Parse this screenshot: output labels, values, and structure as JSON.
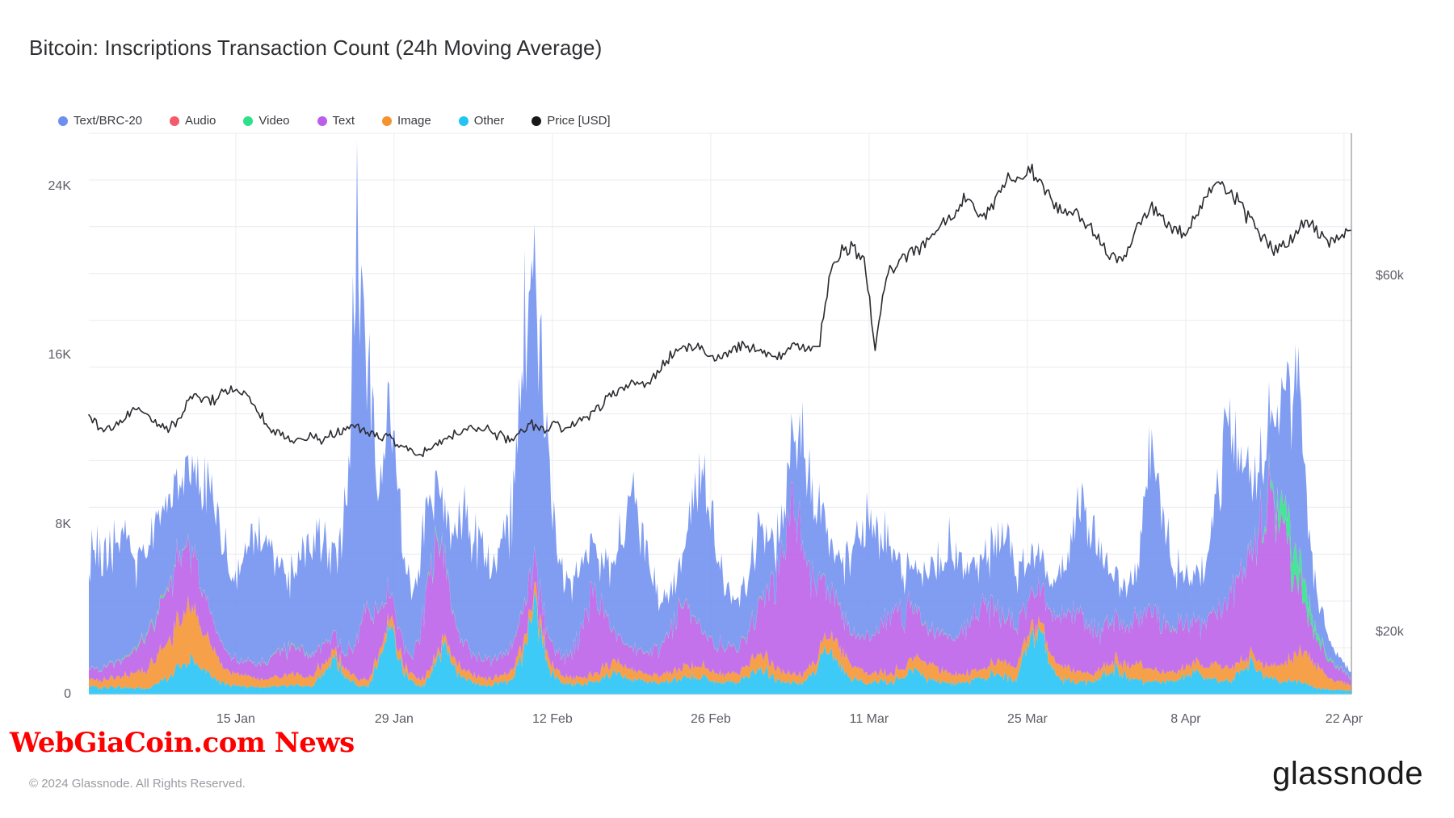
{
  "header": {
    "title": "Bitcoin: Inscriptions Transaction Count (24h Moving Average)"
  },
  "footer": {
    "copyright": "© 2024 Glassnode. All Rights Reserved.",
    "brand": "glassnode",
    "watermark": "WebGiaCoin.com News"
  },
  "legend": [
    {
      "label": "Text/BRC-20",
      "color": "#6f8ff0"
    },
    {
      "label": "Audio",
      "color": "#f45b6a"
    },
    {
      "label": "Video",
      "color": "#2fe08a"
    },
    {
      "label": "Text",
      "color": "#bb5ee8"
    },
    {
      "label": "Image",
      "color": "#f59331"
    },
    {
      "label": "Other",
      "color": "#22c3f5"
    },
    {
      "label": "Price [USD]",
      "color": "#18181b"
    }
  ],
  "chart_data": {
    "type": "area",
    "title": "Bitcoin: Inscriptions Transaction Count (24h Moving Average)",
    "stacked": true,
    "grid": true,
    "legend_position": "top-left",
    "xlabel": "",
    "ylabel": "",
    "x_tick_labels": [
      "15 Jan",
      "29 Jan",
      "12 Feb",
      "26 Feb",
      "11 Mar",
      "25 Mar",
      "8 Apr",
      "22 Apr"
    ],
    "x_tick_positions": [
      0.1164,
      0.2418,
      0.3672,
      0.4926,
      0.618,
      0.7434,
      0.8688,
      0.9942
    ],
    "x_range": [
      "2024-01-01",
      "2024-04-23"
    ],
    "n_points": 114,
    "left_axis": {
      "label": "Inscriptions Transaction Count",
      "tick_labels": [
        "0",
        "8K",
        "16K",
        "24K"
      ],
      "tick_values": [
        0,
        8000,
        16000,
        24000
      ],
      "ylim": [
        0,
        26500
      ],
      "unit": "transactions"
    },
    "right_axis": {
      "label": "Price [USD]",
      "tick_labels": [
        "$20k",
        "$60k"
      ],
      "tick_values": [
        20000,
        60000
      ],
      "ylim": [
        13000,
        76000
      ]
    },
    "series": [
      {
        "name": "Other",
        "color": "#22c3f5",
        "stack_order": 0,
        "values": [
          380,
          300,
          420,
          340,
          300,
          280,
          520,
          760,
          1180,
          1560,
          1340,
          820,
          560,
          440,
          380,
          340,
          320,
          360,
          420,
          380,
          360,
          1020,
          1680,
          820,
          420,
          360,
          1560,
          3480,
          1120,
          520,
          440,
          1540,
          2380,
          1080,
          640,
          480,
          420,
          560,
          760,
          2200,
          4180,
          1480,
          620,
          520,
          480,
          560,
          740,
          1020,
          820,
          660,
          580,
          540,
          620,
          700,
          860,
          740,
          620,
          560,
          600,
          920,
          1340,
          880,
          620,
          560,
          540,
          1120,
          2260,
          1480,
          760,
          640,
          600,
          580,
          640,
          860,
          1180,
          760,
          600,
          560,
          540,
          620,
          800,
          1060,
          820,
          640,
          2380,
          3460,
          1420,
          700,
          620,
          580,
          700,
          960,
          1240,
          820,
          660,
          600,
          580,
          640,
          820,
          1040,
          760,
          620,
          580,
          1060,
          1480,
          900,
          700,
          640,
          600,
          580,
          300,
          240,
          200,
          180,
          160
        ]
      },
      {
        "name": "Image",
        "color": "#f59331",
        "stack_order": 1,
        "values": [
          300,
          340,
          420,
          520,
          660,
          840,
          1180,
          1640,
          2180,
          2460,
          2080,
          1380,
          860,
          620,
          480,
          420,
          400,
          460,
          540,
          500,
          460,
          420,
          380,
          340,
          320,
          300,
          340,
          420,
          380,
          340,
          320,
          300,
          360,
          420,
          380,
          340,
          320,
          360,
          440,
          520,
          480,
          420,
          380,
          360,
          340,
          380,
          460,
          560,
          480,
          420,
          380,
          360,
          420,
          520,
          600,
          520,
          440,
          400,
          420,
          560,
          760,
          620,
          480,
          420,
          400,
          440,
          620,
          880,
          700,
          520,
          460,
          420,
          400,
          440,
          580,
          760,
          560,
          460,
          420,
          400,
          440,
          560,
          700,
          560,
          460,
          420,
          480,
          620,
          520,
          440,
          400,
          380,
          440,
          560,
          720,
          560,
          460,
          420,
          400,
          440,
          580,
          760,
          580,
          460,
          420,
          460,
          620,
          820,
          1240,
          1480,
          980,
          520,
          380,
          300,
          240,
          200,
          180
        ]
      },
      {
        "name": "Text",
        "color": "#bb5ee8",
        "stack_order": 2,
        "values": [
          420,
          480,
          620,
          760,
          1080,
          1480,
          1960,
          2420,
          2880,
          2660,
          2080,
          1420,
          960,
          720,
          640,
          680,
          820,
          1060,
          1320,
          1180,
          940,
          820,
          760,
          700,
          1860,
          3280,
          2140,
          1180,
          940,
          860,
          3240,
          5480,
          3260,
          1560,
          1040,
          920,
          860,
          920,
          1180,
          1680,
          1460,
          1080,
          920,
          860,
          2080,
          3880,
          2640,
          1480,
          1120,
          1020,
          980,
          1240,
          1980,
          3060,
          2480,
          1680,
          1280,
          1140,
          1080,
          1380,
          2180,
          3460,
          5260,
          7480,
          5840,
          3680,
          2460,
          1880,
          1620,
          1520,
          1680,
          2280,
          3180,
          2640,
          2080,
          1780,
          1640,
          1580,
          1760,
          2360,
          3060,
          2580,
          2080,
          1820,
          1700,
          1640,
          1780,
          2180,
          2780,
          2380,
          2020,
          1840,
          1760,
          1880,
          2240,
          2860,
          2420,
          2080,
          1920,
          1840,
          1960,
          2380,
          3180,
          3860,
          4620,
          6480,
          8840,
          6260,
          3480,
          1980,
          1240,
          820,
          540,
          360
        ]
      },
      {
        "name": "Video",
        "color": "#2fe08a",
        "stack_order": 3,
        "values": [
          20,
          20,
          30,
          40,
          60,
          80,
          90,
          80,
          60,
          40,
          30,
          20,
          20,
          20,
          20,
          20,
          30,
          40,
          50,
          40,
          30,
          20,
          20,
          20,
          30,
          40,
          30,
          20,
          20,
          20,
          30,
          160,
          80,
          30,
          20,
          20,
          20,
          20,
          30,
          40,
          30,
          20,
          20,
          20,
          20,
          30,
          30,
          20,
          20,
          20,
          20,
          20,
          30,
          40,
          30,
          20,
          20,
          20,
          20,
          30,
          40,
          30,
          20,
          20,
          20,
          20,
          30,
          40,
          30,
          20,
          20,
          20,
          20,
          20,
          30,
          40,
          30,
          20,
          20,
          20,
          20,
          30,
          40,
          30,
          20,
          20,
          20,
          20,
          20,
          30,
          40,
          30,
          20,
          20,
          20,
          20,
          30,
          40,
          30,
          20,
          20,
          20,
          20,
          30,
          60,
          120,
          340,
          1080,
          1620,
          860,
          280,
          90,
          40,
          20,
          20,
          20
        ]
      },
      {
        "name": "Audio",
        "color": "#f45b6a",
        "stack_order": 4,
        "values": [
          10,
          10,
          15,
          20,
          25,
          30,
          35,
          30,
          25,
          20,
          15,
          10,
          10,
          10,
          10,
          10,
          15,
          20,
          25,
          20,
          15,
          10,
          10,
          10,
          15,
          20,
          15,
          10,
          10,
          10,
          15,
          25,
          20,
          10,
          10,
          10,
          10,
          10,
          15,
          20,
          15,
          10,
          10,
          10,
          10,
          15,
          15,
          10,
          10,
          10,
          10,
          10,
          15,
          20,
          15,
          10,
          10,
          10,
          10,
          15,
          20,
          15,
          10,
          10,
          10,
          10,
          15,
          20,
          15,
          10,
          10,
          10,
          10,
          10,
          15,
          20,
          15,
          10,
          10,
          10,
          10,
          15,
          20,
          15,
          10,
          10,
          10,
          10,
          10,
          15,
          20,
          15,
          10,
          10,
          10,
          10,
          15,
          20,
          15,
          10,
          10,
          10,
          10,
          15,
          20,
          25,
          30,
          40,
          45,
          30,
          20,
          12,
          10,
          8,
          6,
          5
        ]
      },
      {
        "name": "Text/BRC-20",
        "color": "#6f8ff0",
        "stack_order": 5,
        "values": [
          5780,
          4980,
          5420,
          6180,
          4360,
          3480,
          4520,
          3860,
          3280,
          3960,
          5180,
          6280,
          4820,
          3680,
          4980,
          6180,
          5080,
          3780,
          3260,
          4380,
          5860,
          4680,
          3560,
          6480,
          18880,
          12260,
          4860,
          9280,
          4280,
          3180,
          3860,
          2480,
          2180,
          4980,
          6480,
          5280,
          4180,
          5180,
          6880,
          12480,
          14680,
          8280,
          4280,
          3280,
          2860,
          2180,
          1980,
          3280,
          5480,
          7680,
          4480,
          2280,
          1680,
          2080,
          4680,
          7180,
          5280,
          3060,
          2180,
          2480,
          3480,
          2080,
          1480,
          2860,
          5280,
          3880,
          2480,
          2080,
          3180,
          4480,
          5680,
          4180,
          2680,
          2080,
          1780,
          2480,
          3480,
          4180,
          3280,
          2480,
          2180,
          2880,
          4180,
          2680,
          1880,
          1480,
          1280,
          2080,
          3480,
          5680,
          4280,
          2880,
          2180,
          1880,
          2480,
          8480,
          5280,
          2880,
          2180,
          1980,
          2480,
          5680,
          8180,
          5280,
          3280,
          2680,
          3280,
          5280,
          9280,
          4180,
          1680,
          820,
          440,
          280,
          180,
          120
        ]
      }
    ],
    "price_series": {
      "name": "Price [USD]",
      "color": "#2b2b30",
      "unit": "USD",
      "axis": "right",
      "values": [
        44200,
        43100,
        42600,
        43800,
        45200,
        44800,
        43600,
        42800,
        43400,
        46100,
        46600,
        45800,
        46800,
        47400,
        46900,
        45600,
        43200,
        42400,
        41900,
        41400,
        42100,
        41600,
        42300,
        42800,
        43100,
        42700,
        42400,
        41800,
        41300,
        40300,
        39900,
        40800,
        41600,
        42200,
        42900,
        42500,
        42800,
        42100,
        41500,
        42400,
        43300,
        42900,
        43200,
        42800,
        43500,
        44200,
        45100,
        46400,
        47200,
        48100,
        47600,
        48800,
        50200,
        51500,
        51900,
        52100,
        51400,
        50800,
        51600,
        52300,
        51800,
        51300,
        50900,
        51700,
        52400,
        51800,
        52600,
        61200,
        62800,
        63100,
        61900,
        52100,
        59800,
        61800,
        62400,
        63200,
        64100,
        65800,
        66900,
        68200,
        67400,
        66800,
        69100,
        71300,
        70800,
        72100,
        70200,
        68400,
        67100,
        66900,
        65800,
        64200,
        62800,
        61400,
        63100,
        66200,
        67900,
        66400,
        65100,
        64800,
        66900,
        69100,
        70400,
        69200,
        67800,
        66100,
        64300,
        62900,
        63700,
        64800,
        66200,
        65100,
        63900,
        64400,
        65100
      ]
    }
  }
}
